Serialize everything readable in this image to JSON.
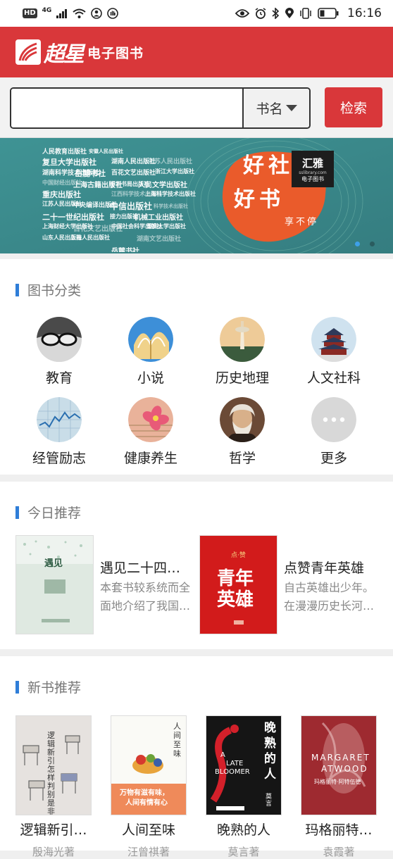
{
  "status_bar": {
    "hd": "HD",
    "network": "4G",
    "time": "16:16",
    "icons": [
      "signal-icon",
      "wifi-icon",
      "hotspot-icon",
      "hand-icon",
      "eye-icon",
      "alarm-icon",
      "bluetooth-icon",
      "location-icon",
      "vibrate-icon",
      "battery-icon"
    ]
  },
  "header": {
    "logo_script": "超星",
    "title": "电子图书",
    "accent": "#d9373a"
  },
  "search": {
    "value": "",
    "placeholder": "",
    "filter_selected": "书名",
    "button_label": "检索"
  },
  "banner": {
    "publishers": [
      "人民教育出版社",
      "安徽人民出版社",
      "复旦大学出版社",
      "湖南人民出版社",
      "江苏人民出版社",
      "湖南科学技术出版社",
      "岳麓书社",
      "百花文艺出版社",
      "浙江大学出版社",
      "中国财经出版社",
      "上海古籍出版社",
      "中华书局出版社",
      "人民文学出版社",
      "重庆出版社",
      "江西科学技术出版社",
      "上海科学技术出版社",
      "江苏人民出版社",
      "中央编译出版社",
      "中信出版社",
      "科学技术出版社",
      "二十一世纪出版社",
      "接力出版社",
      "机械工业出版社",
      "上海财经大学出版社",
      "百花文艺出版社",
      "中国社会科学出版社",
      "重庆大学出版社",
      "山东人民出版社",
      "上海人民出版社",
      "湖南文艺出版社",
      "岳麓书社"
    ],
    "badge_brand": "汇雅",
    "badge_brand_sub": "电子图书",
    "badge_url": "sslibrary.com",
    "slogan_line1": "好社",
    "slogan_line2": "好书",
    "slogan_tag": "享不停",
    "active_slide": 1,
    "slide_count": 2
  },
  "categories": {
    "title": "图书分类",
    "items": [
      {
        "label": "教育",
        "icon": "glasses-icon"
      },
      {
        "label": "小说",
        "icon": "book-pages-icon"
      },
      {
        "label": "历史地理",
        "icon": "tower-icon"
      },
      {
        "label": "人文社科",
        "icon": "temple-icon"
      },
      {
        "label": "经管励志",
        "icon": "stock-chart-icon"
      },
      {
        "label": "健康养生",
        "icon": "flower-icon"
      },
      {
        "label": "哲学",
        "icon": "philosopher-portrait-icon"
      },
      {
        "label": "更多",
        "icon": "more-dots-icon"
      }
    ]
  },
  "today": {
    "title": "今日推荐",
    "items": [
      {
        "title": "遇见二十四…",
        "desc1": "本套书较系统而全",
        "desc2": "面地介绍了我国…",
        "cover_text": "遇见"
      },
      {
        "title": "点赞青年英雄",
        "desc1": "自古英雄出少年。",
        "desc2": "在漫漫历史长河…",
        "cover_text1": "青年",
        "cover_text2": "英雄",
        "cover_top": "点·赞"
      }
    ]
  },
  "new_books": {
    "title": "新书推荐",
    "items": [
      {
        "title": "逻辑新引…",
        "author": "殷海光著",
        "cover_text": "逻辑新引 怎样判别是非"
      },
      {
        "title": "人间至味",
        "author": "汪曾祺著",
        "cover_text": "人间至味",
        "cover_slogan1": "万物有滋有味，",
        "cover_slogan2": "人间有情有心"
      },
      {
        "title": "晚熟的人",
        "author": "莫言著",
        "cover_text": "晚熟的人",
        "cover_en1": "A",
        "cover_en2": "LATE",
        "cover_en3": "BLOOMER",
        "cover_author": "莫言"
      },
      {
        "title": "玛格丽特…",
        "author": "袁霞著",
        "cover_en1": "MARGARET",
        "cover_en2": "ATWOOD",
        "cover_cn": "玛格丽特·阿特伍德"
      }
    ]
  }
}
